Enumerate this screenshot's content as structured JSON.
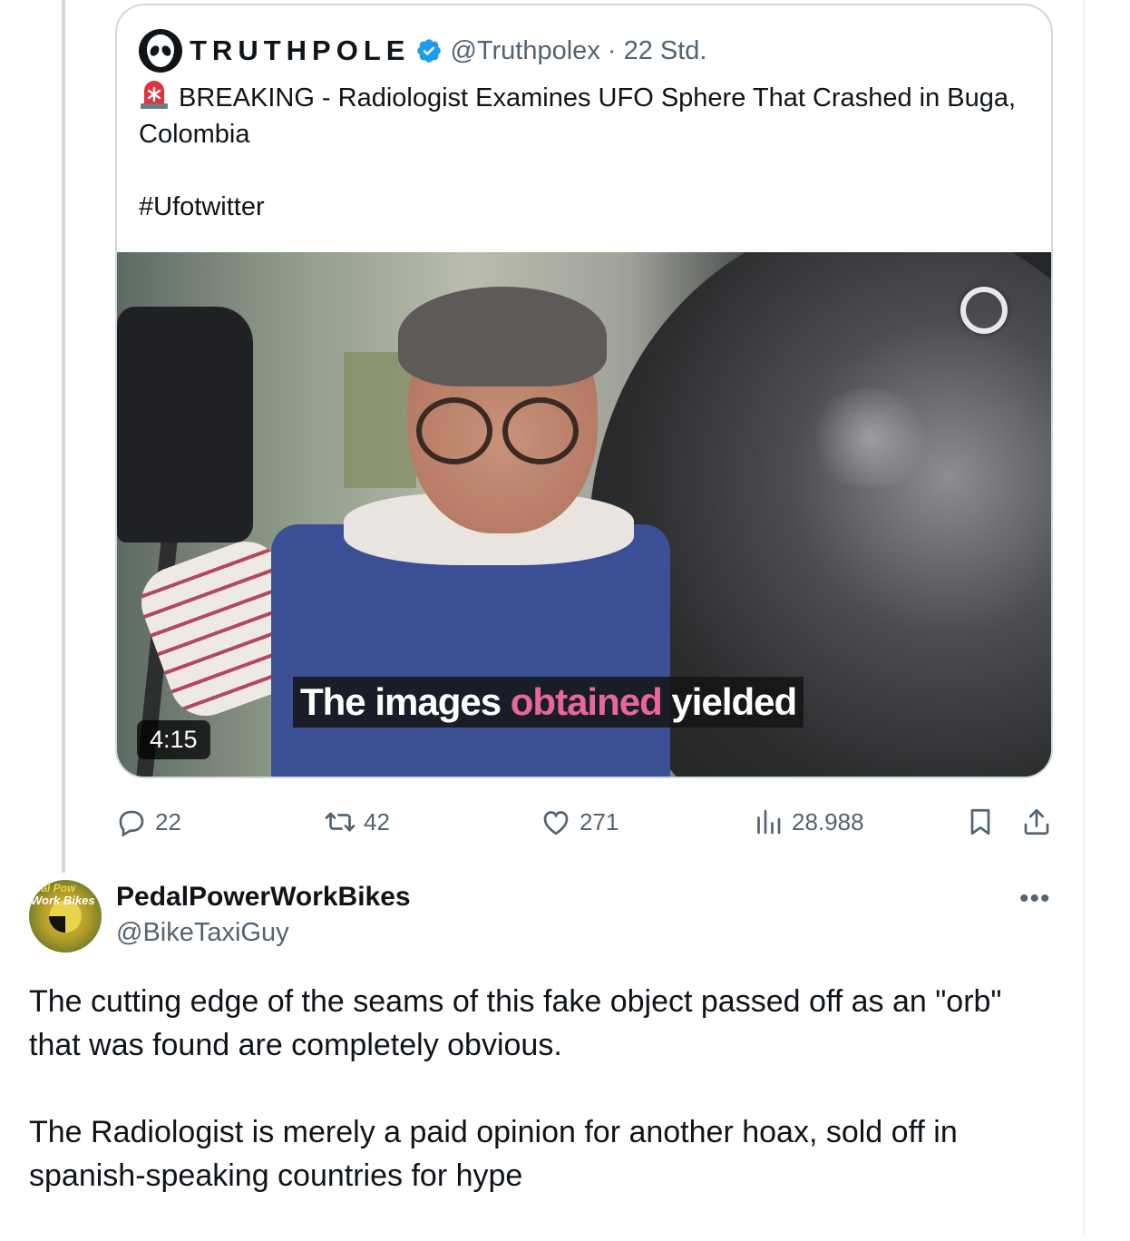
{
  "quoted_post": {
    "author_name": "TRUTHPOLE",
    "handle_time": "@Truthpolex · 22 Std.",
    "text_line": "BREAKING - Radiologist Examines UFO Sphere That Crashed in Buga, Colombia",
    "hashtag": "#Ufotwitter",
    "video": {
      "duration": "4:15",
      "caption_part1": "The images ",
      "caption_highlight": "obtained",
      "caption_part2": " yielded"
    }
  },
  "actions": {
    "replies": "22",
    "reposts": "42",
    "likes": "271",
    "views": "28.988"
  },
  "reply_post": {
    "author_name": "PedalPowerWorkBikes",
    "handle": "@BikeTaxiGuy",
    "avatar_text_top": "dal Pow",
    "avatar_text_mid": "Work Bikes",
    "paragraph1": "The cutting edge of the seams of this fake object passed off as an \"orb\" that was found are completely obvious.",
    "paragraph2": "The Radiologist is merely a paid opinion for another hoax, sold off in spanish-speaking countries for hype"
  },
  "colors": {
    "text_primary": "#0f1419",
    "text_secondary": "#536471",
    "verified_blue": "#1d9bf0",
    "border": "#cfd9de"
  },
  "icons": [
    "alien-avatar-icon",
    "verified-badge-icon",
    "siren-emoji-icon",
    "reply-icon",
    "repost-icon",
    "like-icon",
    "views-icon",
    "bookmark-icon",
    "share-icon",
    "more-icon"
  ]
}
